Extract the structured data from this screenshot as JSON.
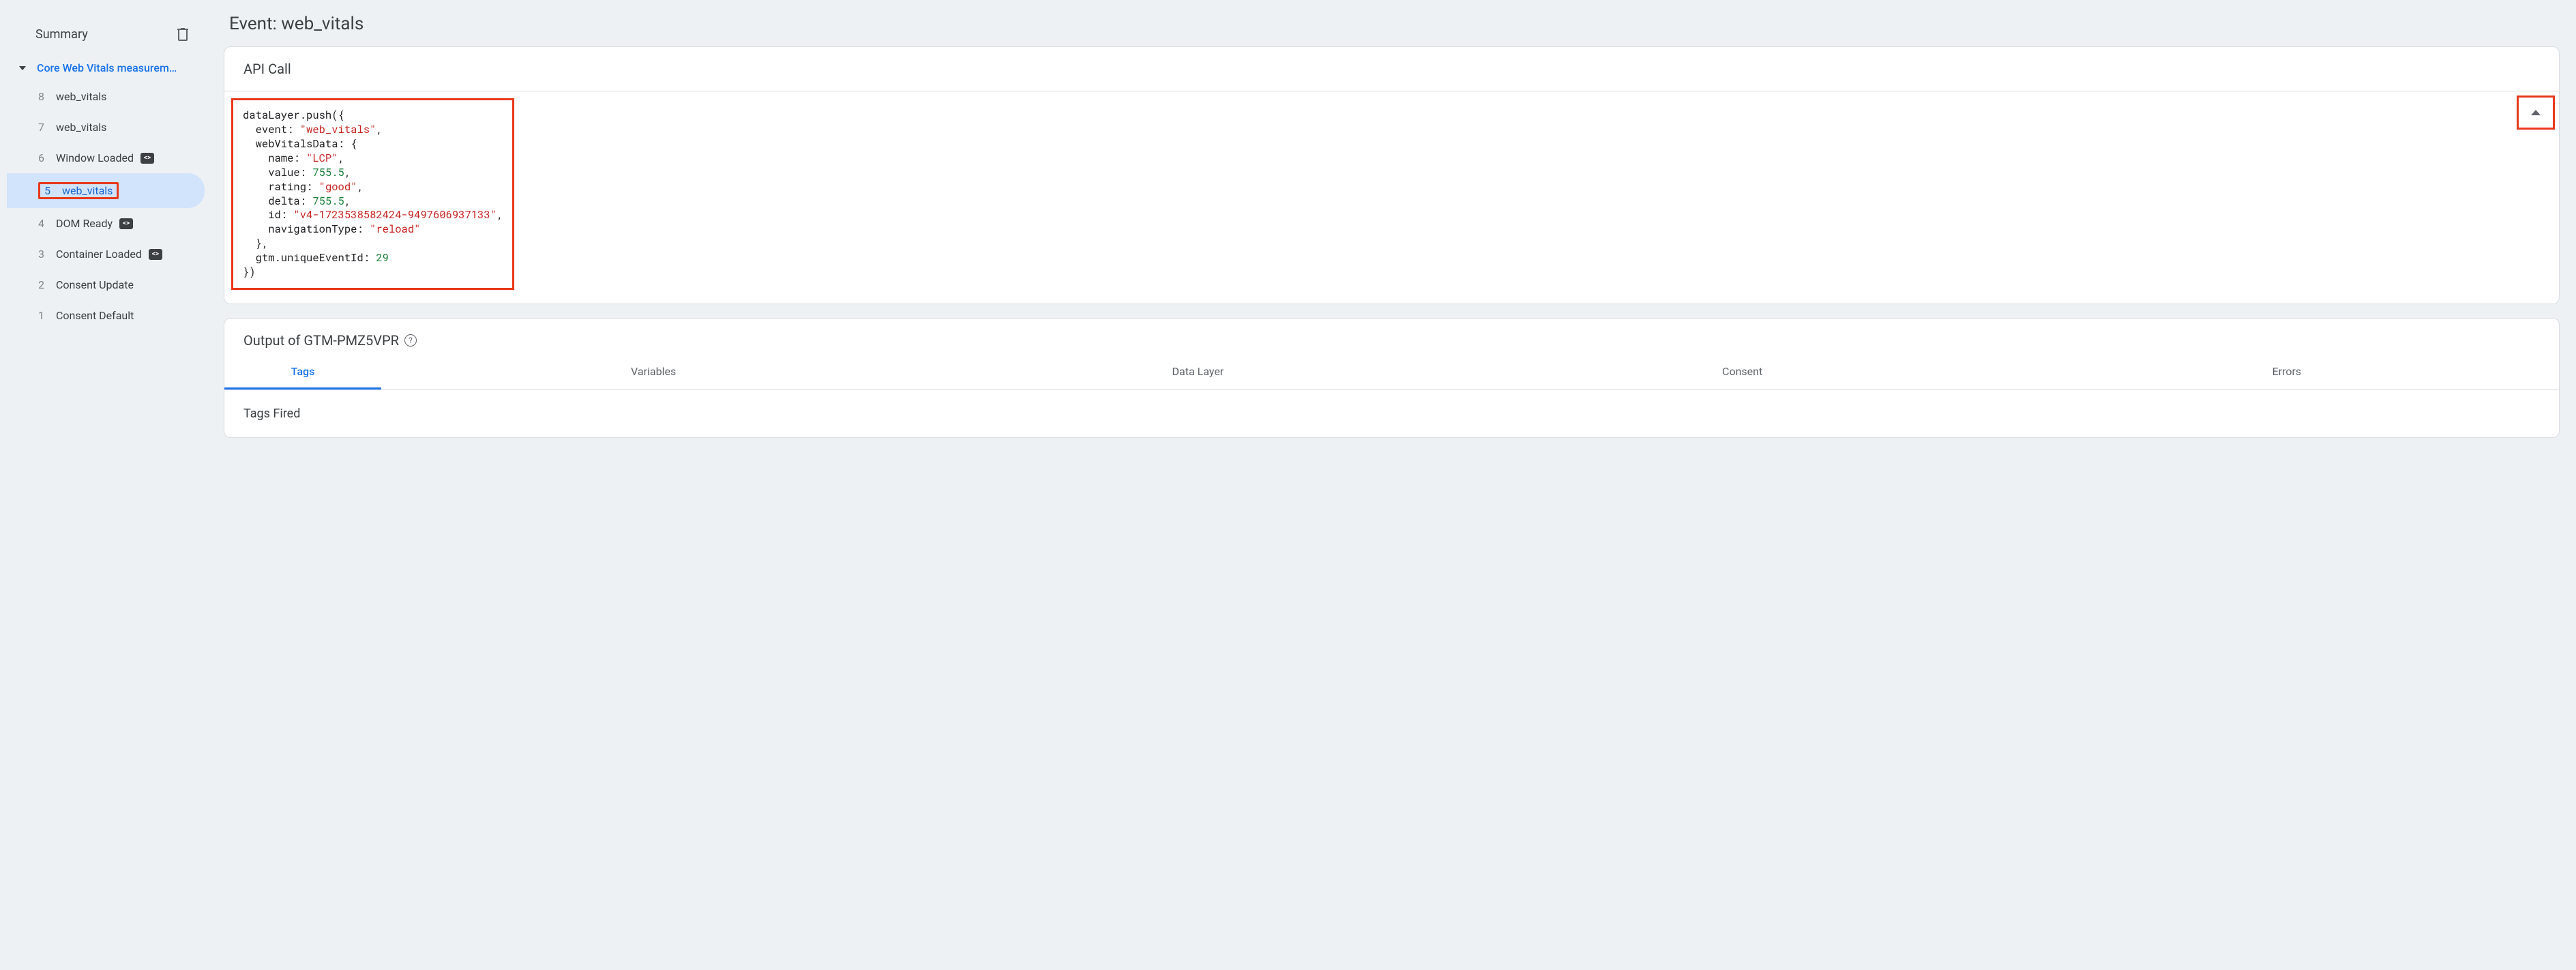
{
  "sidebar": {
    "title": "Summary",
    "group_label": "Core Web Vitals measurem…",
    "events": [
      {
        "num": "8",
        "label": "web_vitals",
        "badge": false,
        "selected": false
      },
      {
        "num": "7",
        "label": "web_vitals",
        "badge": false,
        "selected": false
      },
      {
        "num": "6",
        "label": "Window Loaded",
        "badge": true,
        "selected": false
      },
      {
        "num": "5",
        "label": "web_vitals",
        "badge": false,
        "selected": true
      },
      {
        "num": "4",
        "label": "DOM Ready",
        "badge": true,
        "selected": false
      },
      {
        "num": "3",
        "label": "Container Loaded",
        "badge": true,
        "selected": false
      },
      {
        "num": "2",
        "label": "Consent Update",
        "badge": false,
        "selected": false
      },
      {
        "num": "1",
        "label": "Consent Default",
        "badge": false,
        "selected": false
      }
    ]
  },
  "main": {
    "title": "Event: web_vitals",
    "api_card_title": "API Call",
    "api_call": {
      "fn": "dataLayer.push",
      "event": "web_vitals",
      "webVitalsData": {
        "name": "LCP",
        "value": 755.5,
        "rating": "good",
        "delta": 755.5,
        "id": "v4-1723538582424-9497606937133",
        "navigationType": "reload"
      },
      "gtm_uniqueEventId": 29
    },
    "output_card_title": "Output of GTM-PMZ5VPR",
    "tabs": [
      {
        "label": "Tags",
        "active": true
      },
      {
        "label": "Variables",
        "active": false
      },
      {
        "label": "Data Layer",
        "active": false
      },
      {
        "label": "Consent",
        "active": false
      },
      {
        "label": "Errors",
        "active": false
      }
    ],
    "tags_fired_label": "Tags Fired"
  },
  "highlight_color": "#e8381b"
}
